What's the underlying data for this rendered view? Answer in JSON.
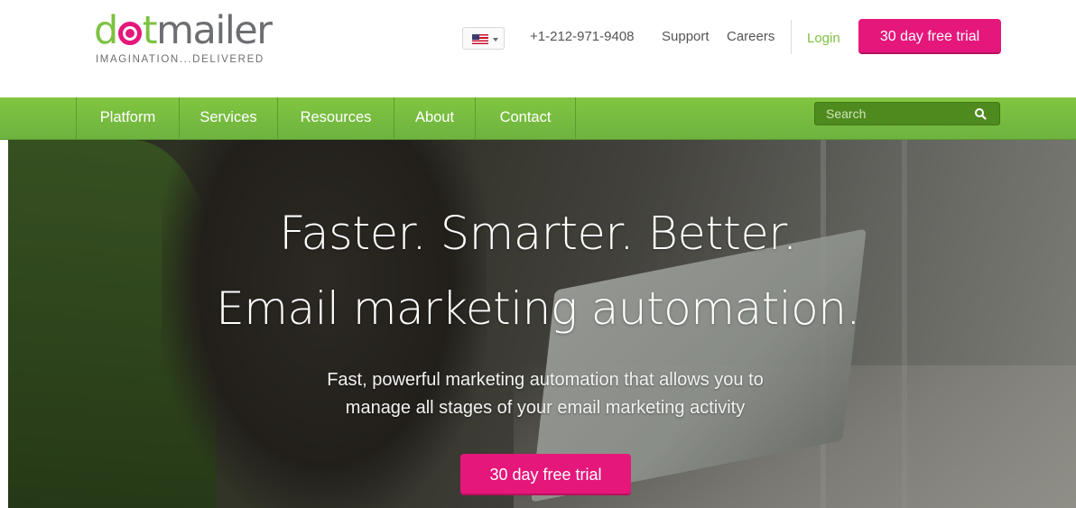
{
  "header": {
    "logo": {
      "text_part1": "d",
      "text_part2": "t",
      "text_part3": "mailer",
      "tagline": "IMAGINATION...DELIVERED"
    },
    "locale_icon": "us-flag-icon",
    "phone": "+1-212-971-9408",
    "support_label": "Support",
    "careers_label": "Careers",
    "login_label": "Login",
    "trial_label": "30 day free trial"
  },
  "nav": {
    "items": [
      {
        "label": "Platform"
      },
      {
        "label": "Services"
      },
      {
        "label": "Resources"
      },
      {
        "label": "About"
      },
      {
        "label": "Contact"
      }
    ],
    "search": {
      "placeholder": "Search",
      "icon": "search-icon"
    }
  },
  "hero": {
    "title_line1": "Faster. Smarter. Better.",
    "title_line2": "Email marketing automation.",
    "subtitle_line1": "Fast, powerful marketing automation that allows you to",
    "subtitle_line2": "manage all stages of your email marketing activity",
    "cta_label": "30 day free trial"
  },
  "colors": {
    "brand_green": "#7dc242",
    "brand_pink": "#e5177b",
    "logo_grey": "#6d6e71"
  }
}
